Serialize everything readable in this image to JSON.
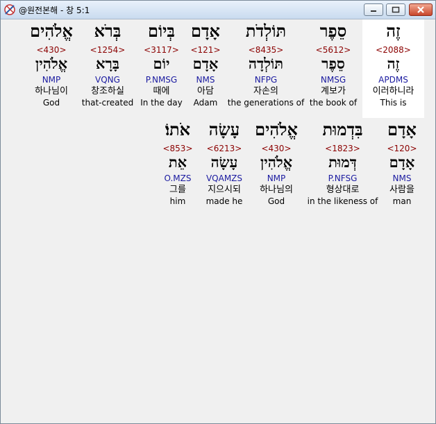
{
  "window": {
    "title": "@원전본해 - 창 5:1"
  },
  "rows": [
    {
      "words": [
        {
          "hebrew": "זֶה",
          "strongs": "<2088>",
          "lemma": "זֶה",
          "parse": "APDMS",
          "korean": "이러하니라",
          "english": "This is",
          "highlight": true
        },
        {
          "hebrew": "סֵפֶר",
          "strongs": "<5612>",
          "lemma": "סֵפֶר",
          "parse": "NMSG",
          "korean": "계보가",
          "english": "the book of"
        },
        {
          "hebrew": "תּוֹלְדֹת",
          "strongs": "<8435>",
          "lemma": "תּוֹלְדָה",
          "parse": "NFPG",
          "korean": "자손의",
          "english": "the generations of"
        },
        {
          "hebrew": "אָדָם",
          "strongs": "<121>",
          "lemma": "אָדָם",
          "parse": "NMS",
          "korean": "아담",
          "english": "Adam"
        },
        {
          "hebrew": "בְּיוֹם",
          "strongs": "<3117>",
          "lemma": "יוֹם",
          "parse": "P.NMSG",
          "korean": "때에",
          "english": "In the day"
        },
        {
          "hebrew": "בְּרֹא",
          "strongs": "<1254>",
          "lemma": "בָּרָא",
          "parse": "VQNG",
          "korean": "창조하실",
          "english": "that-created"
        },
        {
          "hebrew": "אֱלֹהִים",
          "strongs": "<430>",
          "lemma": "אֱלֹהִין",
          "parse": "NMP",
          "korean": "하나님이",
          "english": "God"
        }
      ]
    },
    {
      "words": [
        {
          "hebrew": "אָדָם",
          "strongs": "<120>",
          "lemma": "אָדָם",
          "parse": "NMS",
          "korean": "사람을",
          "english": "man"
        },
        {
          "hebrew": "בִּדְמוּת",
          "strongs": "<1823>",
          "lemma": "דְּמוּת",
          "parse": "P.NFSG",
          "korean": "형상대로",
          "english": "in the likeness of"
        },
        {
          "hebrew": "אֱלֹהִים",
          "strongs": "<430>",
          "lemma": "אֱלֹהִין",
          "parse": "NMP",
          "korean": "하나님의",
          "english": "God"
        },
        {
          "hebrew": "עָשָׂה",
          "strongs": "<6213>",
          "lemma": "עָשָׂה",
          "parse": "VQAMZS",
          "korean": "지으시되",
          "english": "made he"
        },
        {
          "hebrew": "אֹתוֹ׃",
          "strongs": "<853>",
          "lemma": "אֵת",
          "parse": "O.MZS",
          "korean": "그를",
          "english": "him"
        }
      ]
    }
  ]
}
